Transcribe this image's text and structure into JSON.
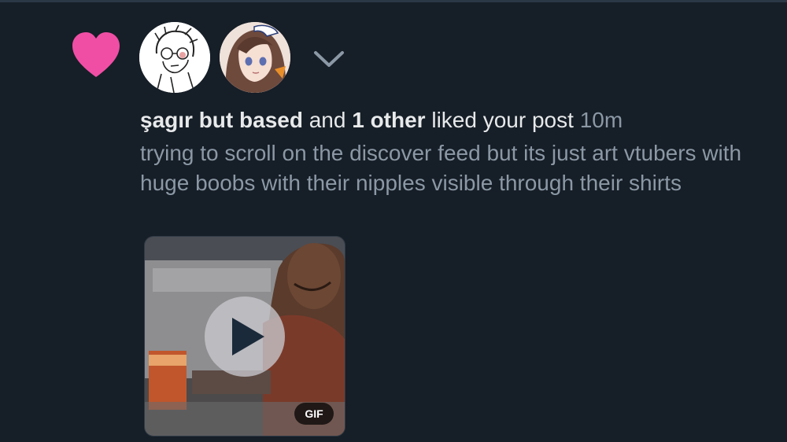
{
  "notification": {
    "type_icon": "heart-icon",
    "actor_name": "şagır but based",
    "connector": "and",
    "others": "1 other",
    "action": "liked your post",
    "time": "10m",
    "post_text": "trying to scroll on the discover feed but its just art vtubers with huge boobs with their nipples visible through their shirts",
    "media": {
      "badge": "GIF",
      "play_icon": "play-icon"
    }
  },
  "colors": {
    "background": "#161e27",
    "heart": "#f04ea5",
    "primary_text": "#e7e9ea",
    "secondary_text": "#8b98a5"
  }
}
